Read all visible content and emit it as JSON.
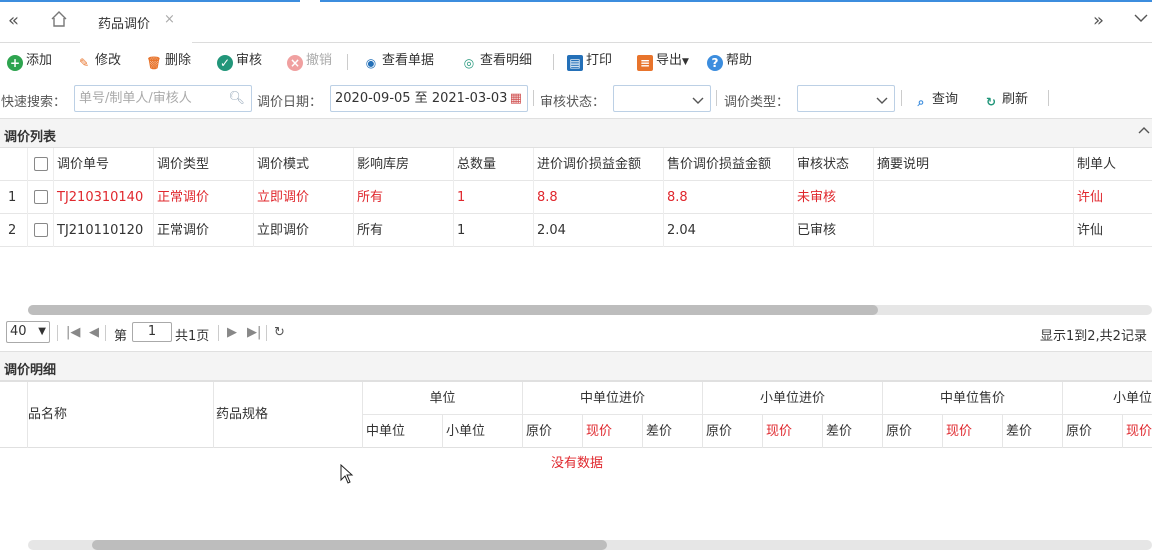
{
  "tabbar": {
    "active_tab": "药品调价",
    "close_glyph": "×"
  },
  "toolbar": {
    "add": "添加",
    "edit": "修改",
    "delete": "删除",
    "audit": "审核",
    "revoke": "撤销",
    "view_doc": "查看单据",
    "view_detail": "查看明细",
    "print": "打印",
    "export": "导出",
    "help": "帮助"
  },
  "filter": {
    "quick_search_label": "快速搜索：",
    "quick_search_placeholder": "单号/制单人/审核人",
    "date_label": "调价日期：",
    "date_value": "2020-09-05 至 2021-03-03",
    "audit_status_label": "审核状态：",
    "audit_status_value": "",
    "price_type_label": "调价类型：",
    "price_type_value": "",
    "query": "查询",
    "refresh": "刷新"
  },
  "list": {
    "title": "调价列表",
    "columns": [
      "调价单号",
      "调价类型",
      "调价模式",
      "影响库房",
      "总数量",
      "进价调价损益金额",
      "售价调价损益金额",
      "审核状态",
      "摘要说明",
      "制单人"
    ],
    "rows": [
      {
        "idx": "1",
        "no": "TJ210310140",
        "type": "正常调价",
        "mode": "立即调价",
        "store": "所有",
        "qty": "1",
        "in_amt": "8.8",
        "out_amt": "8.8",
        "status": "未审核",
        "memo": "",
        "maker": "许仙"
      },
      {
        "idx": "2",
        "no": "TJ210110120",
        "type": "正常调价",
        "mode": "立即调价",
        "store": "所有",
        "qty": "1",
        "in_amt": "2.04",
        "out_amt": "2.04",
        "status": "已审核",
        "memo": "",
        "maker": "许仙"
      }
    ]
  },
  "pager": {
    "page_size": "40",
    "page_prefix": "第",
    "page_value": "1",
    "page_total": "共1页",
    "summary": "显示1到2,共2记录"
  },
  "detail": {
    "title": "调价明细",
    "col_name": "品名称",
    "col_spec": "药品规格",
    "group_unit": "单位",
    "group_mid_in": "中单位进价",
    "group_small_in": "小单位进价",
    "group_mid_out": "中单位售价",
    "group_small_out": "小单位",
    "sub_mid_unit": "中单位",
    "sub_small_unit": "小单位",
    "sub_orig": "原价",
    "sub_now": "现价",
    "sub_diff": "差价",
    "no_data": "没有数据"
  },
  "colors": {
    "accent": "#3c8dde",
    "alert_red": "#e0282e"
  }
}
